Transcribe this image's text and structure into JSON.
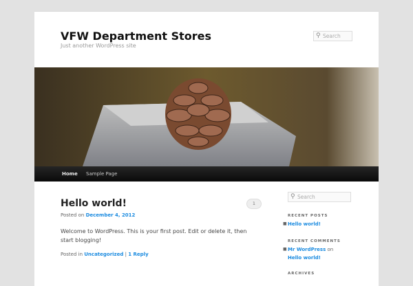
{
  "site": {
    "title": "VFW Department Stores",
    "description": "Just another WordPress site"
  },
  "header_search": {
    "placeholder": "Search"
  },
  "nav": {
    "items": [
      "Home",
      "Sample Page"
    ]
  },
  "post": {
    "title": "Hello world!",
    "posted_on": "Posted on",
    "date": "December 4, 2012",
    "content": "Welcome to WordPress. This is your first post. Edit or delete it, then start blogging!",
    "posted_in": "Posted in",
    "category": "Uncategorized",
    "sep": "|",
    "replies": "1 Reply",
    "comment_count": "1"
  },
  "sidebar": {
    "search_placeholder": "Search",
    "recent_posts_title": "RECENT POSTS",
    "recent_posts": [
      "Hello world!"
    ],
    "recent_comments_title": "RECENT COMMENTS",
    "comment_author": "Mr WordPress",
    "comment_on": "on",
    "comment_post": "Hello world!",
    "archives_title": "ARCHIVES"
  }
}
